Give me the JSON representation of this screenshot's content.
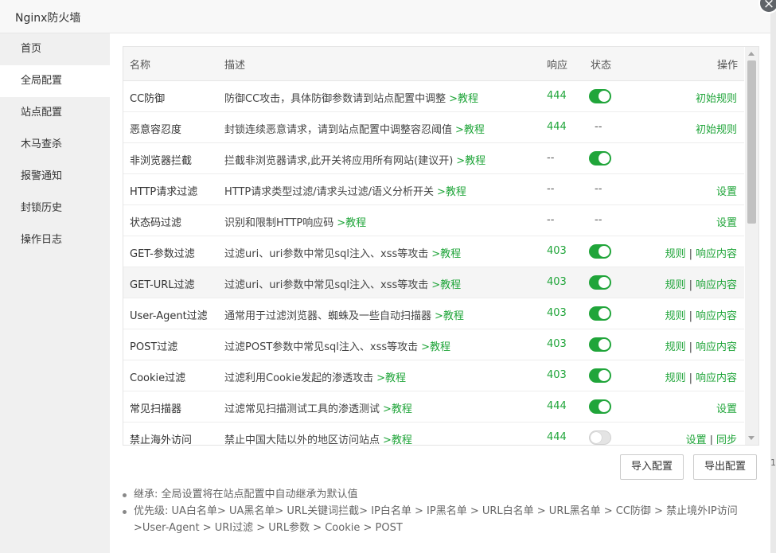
{
  "window": {
    "title": "Nginx防火墙",
    "close_glyph": "×"
  },
  "sidebar": {
    "items": [
      {
        "label": "首页",
        "active": false
      },
      {
        "label": "全局配置",
        "active": true
      },
      {
        "label": "站点配置",
        "active": false
      },
      {
        "label": "木马查杀",
        "active": false
      },
      {
        "label": "报警通知",
        "active": false
      },
      {
        "label": "封锁历史",
        "active": false
      },
      {
        "label": "操作日志",
        "active": false
      }
    ]
  },
  "table": {
    "headers": {
      "name": "名称",
      "desc": "描述",
      "resp": "响应",
      "status": "状态",
      "ops": "操作"
    },
    "rows": [
      {
        "name": "CC防御",
        "desc": "防御CC攻击，具体防御参数请到站点配置中调整",
        "link": ">教程",
        "resp": "444",
        "status": "on",
        "ops": [
          "初始规则"
        ]
      },
      {
        "name": "恶意容忍度",
        "desc": "封锁连续恶意请求，请到站点配置中调整容忍阈值",
        "link": ">教程",
        "resp": "444",
        "status": "--",
        "ops": [
          "初始规则"
        ]
      },
      {
        "name": "非浏览器拦截",
        "desc": "拦截非浏览器请求,此开关将应用所有网站(建议开)",
        "link": ">教程",
        "resp": "--",
        "status": "on",
        "ops": []
      },
      {
        "name": "HTTP请求过滤",
        "desc": "HTTP请求类型过滤/请求头过滤/语义分析开关",
        "link": ">教程",
        "resp": "--",
        "status": "--",
        "ops": [
          "设置"
        ]
      },
      {
        "name": "状态码过滤",
        "desc": "识别和限制HTTP响应码",
        "link": ">教程",
        "resp": "--",
        "status": "--",
        "ops": [
          "设置"
        ]
      },
      {
        "name": "GET-参数过滤",
        "desc": "过滤uri、uri参数中常见sql注入、xss等攻击",
        "link": ">教程",
        "resp": "403",
        "status": "on",
        "ops": [
          "规则",
          "响应内容"
        ]
      },
      {
        "name": "GET-URL过滤",
        "desc": "过滤uri、uri参数中常见sql注入、xss等攻击",
        "link": ">教程",
        "resp": "403",
        "status": "on",
        "ops": [
          "规则",
          "响应内容"
        ],
        "hover": true
      },
      {
        "name": "User-Agent过滤",
        "desc": "通常用于过滤浏览器、蜘蛛及一些自动扫描器",
        "link": ">教程",
        "resp": "403",
        "status": "on",
        "ops": [
          "规则",
          "响应内容"
        ]
      },
      {
        "name": "POST过滤",
        "desc": "过滤POST参数中常见sql注入、xss等攻击",
        "link": ">教程",
        "resp": "403",
        "status": "on",
        "ops": [
          "规则",
          "响应内容"
        ]
      },
      {
        "name": "Cookie过滤",
        "desc": "过滤利用Cookie发起的渗透攻击",
        "link": ">教程",
        "resp": "403",
        "status": "on",
        "ops": [
          "规则",
          "响应内容"
        ]
      },
      {
        "name": "常见扫描器",
        "desc": "过滤常见扫描测试工具的渗透测试",
        "link": ">教程",
        "resp": "444",
        "status": "on",
        "ops": [
          "设置"
        ]
      },
      {
        "name": "禁止海外访问",
        "desc": "禁止中国大陆以外的地区访问站点",
        "link": ">教程",
        "resp": "444",
        "status": "off",
        "ops": [
          "设置",
          "同步"
        ]
      }
    ],
    "ops_separator": "|"
  },
  "buttons": {
    "import": "导入配置",
    "export": "导出配置"
  },
  "notes": [
    "继承: 全局设置将在站点配置中自动继承为默认值",
    "优先级: UA白名单> UA黑名单> URL关键词拦截> IP白名单 > IP黑名单 > URL白名单 > URL黑名单 > CC防御 > 禁止境外IP访问",
    ">User-Agent > URI过滤 > URL参数 > Cookie > POST"
  ],
  "colors": {
    "accent": "#20a53a",
    "sidebar_bg": "#f0f0f0",
    "header_bg": "#f6f6f6"
  },
  "edge_stub": "1"
}
